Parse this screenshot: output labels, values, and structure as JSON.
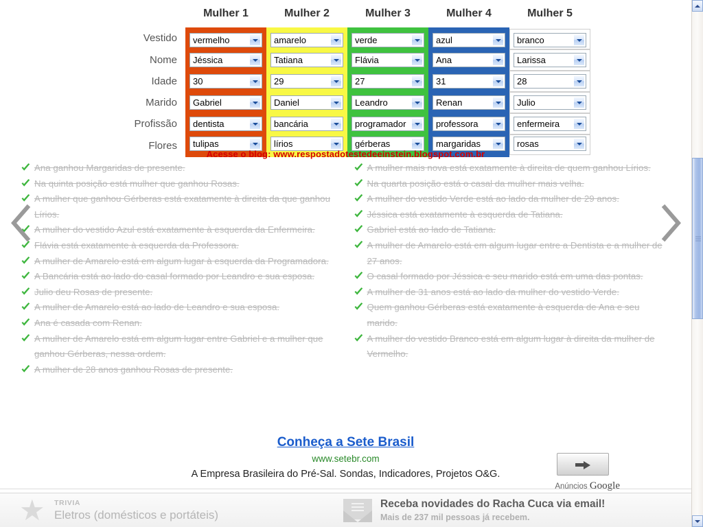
{
  "table": {
    "column_headers": [
      "Mulher 1",
      "Mulher 2",
      "Mulher 3",
      "Mulher 4",
      "Mulher 5"
    ],
    "row_labels": [
      "Vestido",
      "Nome",
      "Idade",
      "Marido",
      "Profissão",
      "Flores"
    ],
    "column_colors": [
      "#de4a0b",
      "#f8f845",
      "#3fc23f",
      "#2a64b4",
      "#ffffff"
    ],
    "columns": [
      {
        "header": "Mulher 1",
        "band": "band-red",
        "values": [
          "vermelho",
          "Jéssica",
          "30",
          "Gabriel",
          "dentista",
          "tulipas"
        ]
      },
      {
        "header": "Mulher 2",
        "band": "band-yellow",
        "values": [
          "amarelo",
          "Tatiana",
          "29",
          "Daniel",
          "bancária",
          "lírios"
        ]
      },
      {
        "header": "Mulher 3",
        "band": "band-green",
        "values": [
          "verde",
          "Flávia",
          "27",
          "Leandro",
          "programador",
          "gérberas"
        ]
      },
      {
        "header": "Mulher 4",
        "band": "band-blue",
        "values": [
          "azul",
          "Ana",
          "31",
          "Renan",
          "professora",
          "margaridas"
        ]
      },
      {
        "header": "Mulher 5",
        "band": "band-white",
        "values": [
          "branco",
          "Larissa",
          "28",
          "Julio",
          "enfermeira",
          "rosas"
        ]
      }
    ]
  },
  "blog_line": "Acesse o blog: www.respostadotestedeeinstein.blogspot.com.br",
  "clues": {
    "left": [
      "Ana ganhou Margaridas de presente.",
      "Na quinta posição está mulher que ganhou Rosas.",
      "A mulher que ganhou Gérberas está exatamente à direita da que ganhou Lírios.",
      "A mulher do vestido Azul está exatamente à esquerda da Enfermeira.",
      "Flávia está exatamente à esquerda da Professora.",
      "A mulher de Amarelo está em algum lugar à esquerda da Programadora.",
      "A Bancária está ao lado do casal formado por Leandro e sua esposa.",
      "Julio deu Rosas de presente.",
      "A mulher de Amarelo está ao lado de Leandro e sua esposa.",
      "Ana é casada com Renan.",
      "A mulher de Amarelo está em algum lugar entre Gabriel e a mulher que ganhou Gérberas, nessa ordem.",
      "A mulher de 28 anos ganhou Rosas de presente."
    ],
    "right": [
      "A mulher mais nova está exatamente à direita de quem ganhou Lírios.",
      "Na quarta posição está o casal da mulher mais velha.",
      "A mulher do vestido Verde está ao lado da mulher de 29 anos.",
      "Jéssica está exatamente à esquerda de Tatiana.",
      "Gabriel está ao lado de Tatiana.",
      "A mulher de Amarelo está em algum lugar entre a Dentista e a mulher de 27 anos.",
      "O casal formado por Jéssica e seu marido está em uma das pontas.",
      "A mulher de 31 anos está ao lado da mulher do vestido Verde.",
      "Quem ganhou Gérberas está exatamente à esquerda de Ana e seu marido.",
      "A mulher do vestido Branco está em algum lugar à direita da mulher de Vermelho."
    ]
  },
  "ad": {
    "title": "Conheça a Sete Brasil",
    "url": "www.setebr.com",
    "description": "A Empresa Brasileira do Pré-Sal. Sondas, Indicadores, Projetos O&G.",
    "brand_prefix": "Anúncios ",
    "brand_name": "Google"
  },
  "footer": {
    "trivia_label": "TRIVIA",
    "trivia_title": "Eletros (domésticos e portáteis)",
    "newsletter_title": "Receba novidades do Racha Cuca via email!",
    "newsletter_sub": "Mais de 237 mil pessoas já recebem."
  },
  "nav": {
    "prev": "previous-puzzle",
    "next": "next-puzzle"
  }
}
